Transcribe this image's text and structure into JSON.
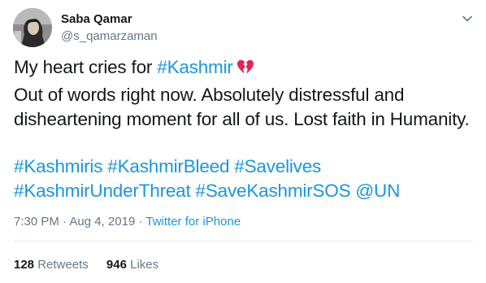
{
  "tweet": {
    "author": {
      "name": "Saba Qamar",
      "handle": "@s_qamarzaman"
    },
    "text": {
      "line1_prefix": "My heart cries for ",
      "line1_hashtag": "#Kashmir",
      "line2": "Out of words right now. Absolutely distressful and",
      "line3": "disheartening moment for all of us. Lost faith in Humanity."
    },
    "hashtags_line1": [
      "#Kashmiris",
      "#KashmirBleed",
      "#Savelives"
    ],
    "hashtags_line2": [
      "#KashmirUnderThreat",
      "#SaveKashmirSOS",
      "@UN"
    ],
    "meta": {
      "time": "7:30 PM",
      "separator": " · ",
      "date": "Aug 4, 2019",
      "source": "Twitter for iPhone"
    },
    "stats": {
      "retweets_count": "128",
      "retweets_label": "Retweets",
      "likes_count": "946",
      "likes_label": "Likes"
    },
    "colors": {
      "link": "#1b95e0",
      "secondary_text": "#657786",
      "primary_text": "#14171a",
      "broken_heart": "#e0245e"
    },
    "icons": {
      "menu": "chevron-down-icon",
      "emoji": "broken-heart-icon"
    }
  }
}
